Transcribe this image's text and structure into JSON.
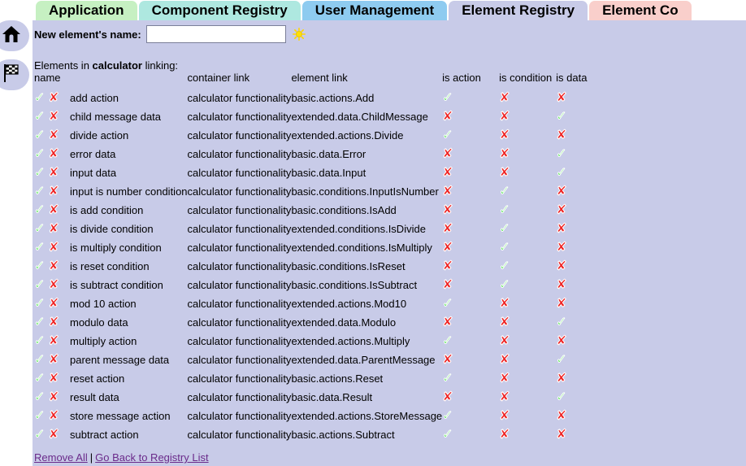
{
  "tabs": [
    {
      "label": "Application",
      "color": "#c6f0c2",
      "active": false
    },
    {
      "label": "Component Registry",
      "color": "#aee8e0",
      "active": false
    },
    {
      "label": "User Management",
      "color": "#8ecbf0",
      "active": false
    },
    {
      "label": "Element Registry",
      "color": "#c8cbe8",
      "active": true
    },
    {
      "label": "Element Co",
      "color": "#f9cfcb",
      "active": false
    }
  ],
  "rail": {
    "home_icon": "home-icon",
    "flag_icon": "checkered-flag-icon"
  },
  "form": {
    "new_element_label": "New element's name:",
    "new_element_value": "",
    "new_element_placeholder": "",
    "add_icon": "sun-icon"
  },
  "subtitle": {
    "prefix": "Elements in ",
    "registry": "calculator",
    "suffix": " linking:"
  },
  "table": {
    "headers": {
      "name": "name",
      "container_link": "container link",
      "element_link": "element link",
      "is_action": "is action",
      "is_condition": "is condition",
      "is_data": "is data"
    },
    "row_icons": {
      "edit": "green-check-icon",
      "delete": "red-x-icon"
    },
    "rows": [
      {
        "name": "add action",
        "container": "calculator functionality",
        "element": "basic.actions.Add",
        "is_action": true,
        "is_condition": false,
        "is_data": false
      },
      {
        "name": "child message data",
        "container": "calculator functionality",
        "element": "extended.data.ChildMessage",
        "is_action": false,
        "is_condition": false,
        "is_data": true
      },
      {
        "name": "divide action",
        "container": "calculator functionality",
        "element": "extended.actions.Divide",
        "is_action": true,
        "is_condition": false,
        "is_data": false
      },
      {
        "name": "error data",
        "container": "calculator functionality",
        "element": "basic.data.Error",
        "is_action": false,
        "is_condition": false,
        "is_data": true
      },
      {
        "name": "input data",
        "container": "calculator functionality",
        "element": "basic.data.Input",
        "is_action": false,
        "is_condition": false,
        "is_data": true
      },
      {
        "name": "input is number condition",
        "container": "calculator functionality",
        "element": "basic.conditions.InputIsNumber",
        "is_action": false,
        "is_condition": true,
        "is_data": false
      },
      {
        "name": "is add condition",
        "container": "calculator functionality",
        "element": "basic.conditions.IsAdd",
        "is_action": false,
        "is_condition": true,
        "is_data": false
      },
      {
        "name": "is divide condition",
        "container": "calculator functionality",
        "element": "extended.conditions.IsDivide",
        "is_action": false,
        "is_condition": true,
        "is_data": false
      },
      {
        "name": "is multiply condition",
        "container": "calculator functionality",
        "element": "extended.conditions.IsMultiply",
        "is_action": false,
        "is_condition": true,
        "is_data": false
      },
      {
        "name": "is reset condition",
        "container": "calculator functionality",
        "element": "basic.conditions.IsReset",
        "is_action": false,
        "is_condition": true,
        "is_data": false
      },
      {
        "name": "is subtract condition",
        "container": "calculator functionality",
        "element": "basic.conditions.IsSubtract",
        "is_action": false,
        "is_condition": true,
        "is_data": false
      },
      {
        "name": "mod 10 action",
        "container": "calculator functionality",
        "element": "extended.actions.Mod10",
        "is_action": true,
        "is_condition": false,
        "is_data": false
      },
      {
        "name": "modulo data",
        "container": "calculator functionality",
        "element": "extended.data.Modulo",
        "is_action": false,
        "is_condition": false,
        "is_data": true
      },
      {
        "name": "multiply action",
        "container": "calculator functionality",
        "element": "extended.actions.Multiply",
        "is_action": true,
        "is_condition": false,
        "is_data": false
      },
      {
        "name": "parent message data",
        "container": "calculator functionality",
        "element": "extended.data.ParentMessage",
        "is_action": false,
        "is_condition": false,
        "is_data": true
      },
      {
        "name": "reset action",
        "container": "calculator functionality",
        "element": "basic.actions.Reset",
        "is_action": true,
        "is_condition": false,
        "is_data": false
      },
      {
        "name": "result data",
        "container": "calculator functionality",
        "element": "basic.data.Result",
        "is_action": false,
        "is_condition": false,
        "is_data": true
      },
      {
        "name": "store message action",
        "container": "calculator functionality",
        "element": "extended.actions.StoreMessage",
        "is_action": true,
        "is_condition": false,
        "is_data": false
      },
      {
        "name": "subtract action",
        "container": "calculator functionality",
        "element": "basic.actions.Subtract",
        "is_action": true,
        "is_condition": false,
        "is_data": false
      }
    ]
  },
  "footer": {
    "remove_all": "Remove All",
    "separator": "|",
    "go_back": "Go Back to Registry List"
  },
  "glyphs": {
    "check": "✓",
    "cross": "✘"
  },
  "colors": {
    "panel_bg": "#c8cbe8",
    "check_green": "#33dd33",
    "cross_red": "#ee2222",
    "link_purple": "#6a2a8a",
    "accent_yellow": "#ffe000"
  }
}
